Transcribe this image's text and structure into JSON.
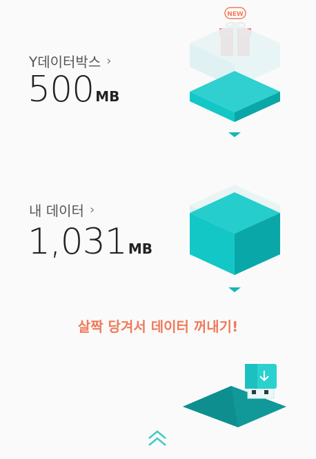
{
  "y_data_box": {
    "label": "Y데이터박스",
    "chevron": "›",
    "amount": "500",
    "unit": "MB",
    "badge": "NEW",
    "gift_icon": "gift-icon"
  },
  "my_data": {
    "label": "내 데이터",
    "chevron": "›",
    "amount": "1,031",
    "unit": "MB"
  },
  "hint": "살짝 당겨서 데이터 꺼내기!",
  "colors": {
    "teal": "#14c7c7",
    "teal_dark": "#0aa7a8",
    "accent": "#f07a5a",
    "gift": "#f25c5c"
  }
}
